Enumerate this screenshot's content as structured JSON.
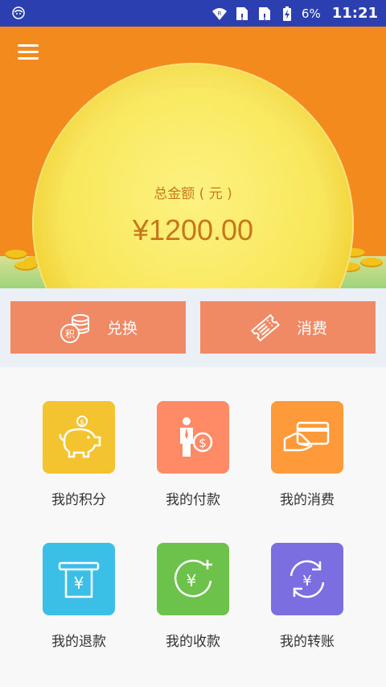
{
  "status_bar": {
    "battery_percent": "6%",
    "time": "11:21"
  },
  "hero": {
    "label": "总金额 ( 元 )",
    "amount": "¥1200.00"
  },
  "actions": [
    {
      "label": "兑换",
      "icon": "points-exchange-icon",
      "color": "#f08a64"
    },
    {
      "label": "消费",
      "icon": "ticket-icon",
      "color": "#f08a64"
    }
  ],
  "tiles": [
    {
      "label": "我的积分",
      "icon": "piggy-bank-icon",
      "color": "#f4c430"
    },
    {
      "label": "我的付款",
      "icon": "payer-icon",
      "color": "#ff8a66"
    },
    {
      "label": "我的消费",
      "icon": "card-hand-icon",
      "color": "#ff9a3b"
    },
    {
      "label": "我的退款",
      "icon": "refund-receipt-icon",
      "color": "#3bbfe6"
    },
    {
      "label": "我的收款",
      "icon": "receive-money-icon",
      "color": "#6cc24a"
    },
    {
      "label": "我的转账",
      "icon": "transfer-icon",
      "color": "#7a6ee0"
    }
  ],
  "colors": {
    "status_bar": "#2b3fb0",
    "hero_background": "#f28a1e",
    "amount_text": "#c8761a"
  }
}
